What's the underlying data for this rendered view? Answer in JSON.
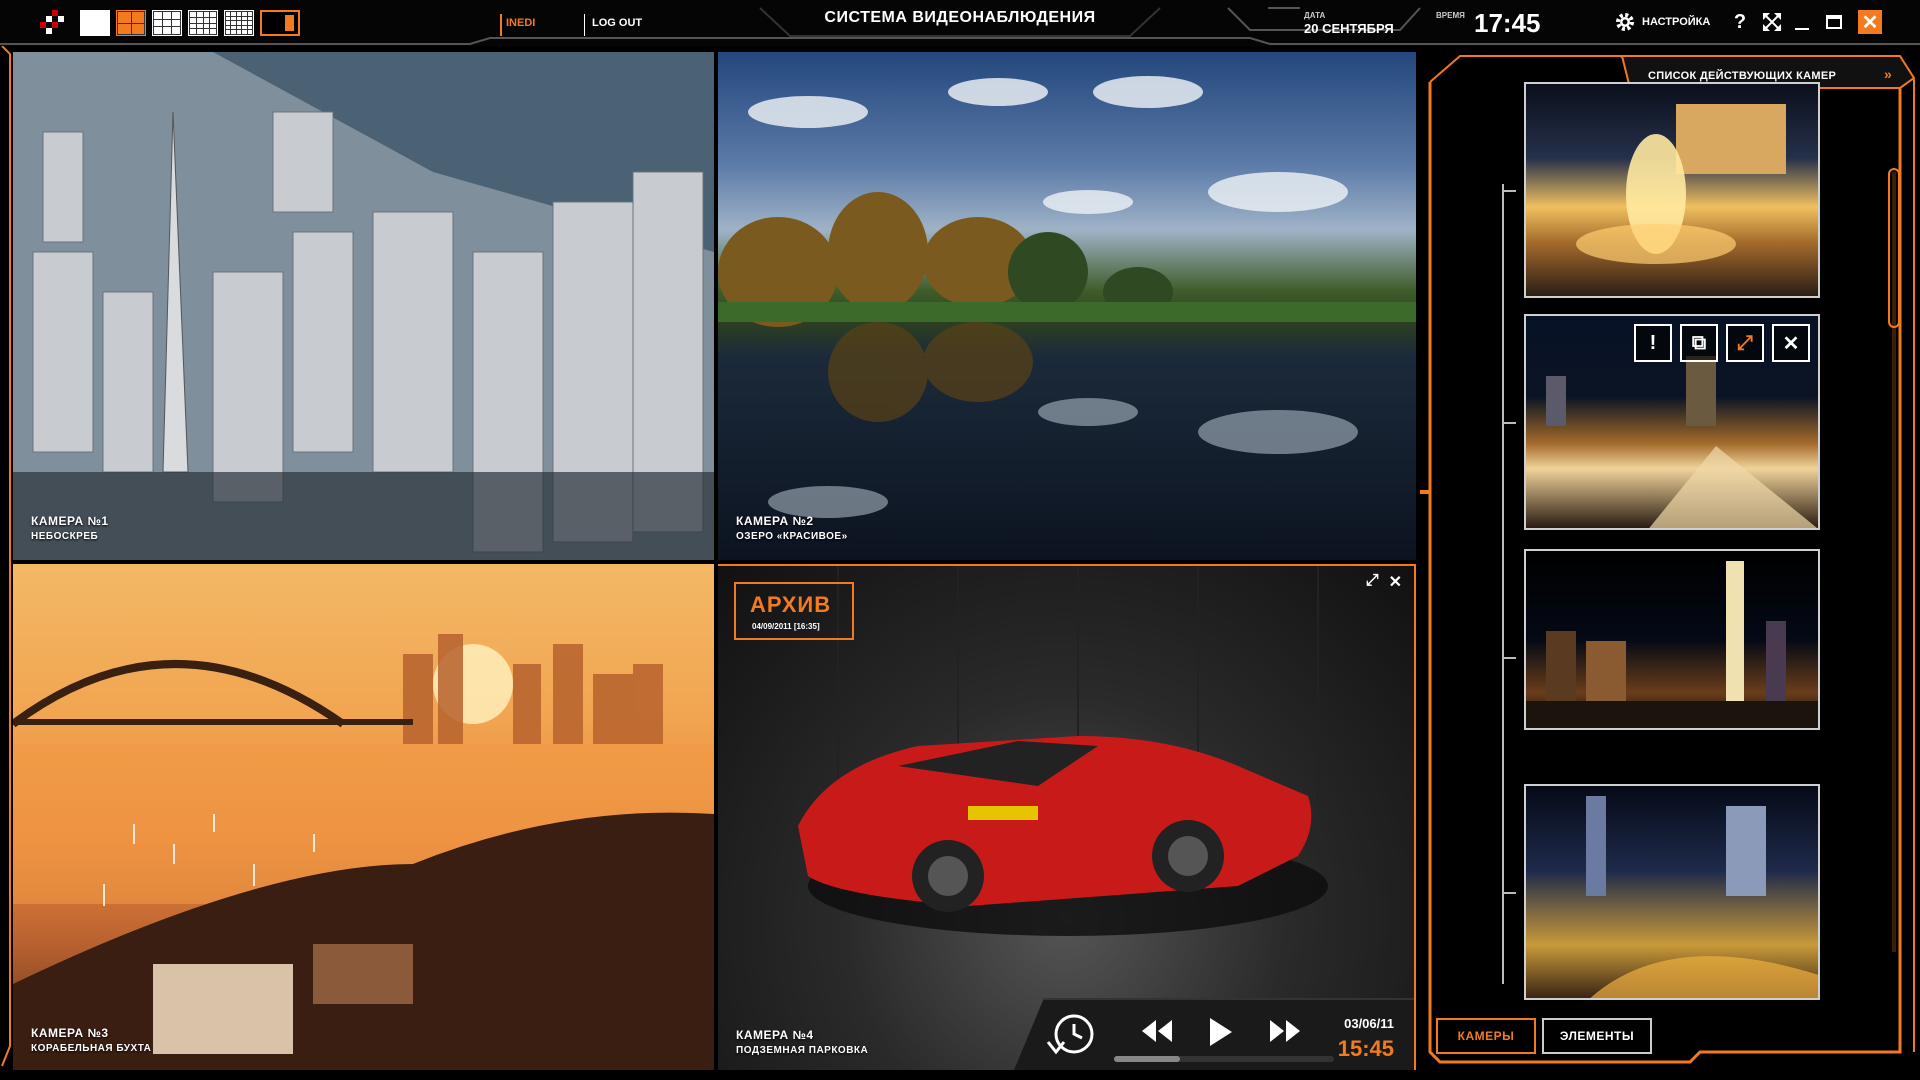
{
  "header": {
    "user_name": "INEDI",
    "logout_label": "LOG OUT",
    "app_title": "СИСТЕМА ВИДЕОНАБЛЮДЕНИЯ",
    "date_label": "ДАТА",
    "date_value": "20 СЕНТЯБРЯ",
    "time_label": "ВРЕМЯ",
    "time_value": "17:45",
    "settings_label": "НАСТРОЙКА",
    "help_symbol": "?",
    "close_symbol": "✕"
  },
  "layout_buttons": [
    "1x1",
    "2x2",
    "3x3",
    "4x4",
    "5x5",
    "panel"
  ],
  "cameras": [
    {
      "number": "КАМЕРА №1",
      "name": "НЕБОСКРЕБ"
    },
    {
      "number": "КАМЕРА №2",
      "name": "ОЗЕРО «КРАСИВОЕ»"
    },
    {
      "number": "КАМЕРА №3",
      "name": "КОРАБЕЛЬНАЯ БУХТА"
    },
    {
      "number": "КАМЕРА №4",
      "name": "ПОДЗЕМНАЯ ПАРКОВКА"
    }
  ],
  "archive": {
    "title": "АРХИВ",
    "subtitle": "04/09/2011 [16:35]"
  },
  "playback": {
    "date": "03/06/11",
    "time": "15:45",
    "progress": 0.3
  },
  "side_panel": {
    "title": "СПИСОК ДЕЙСТВУЮЩИХ КАМЕР",
    "tab_cameras": "КАМЕРЫ",
    "tab_elements": "ЭЛЕМЕНТЫ"
  },
  "colors": {
    "accent": "#f37a1f",
    "background": "#000000"
  }
}
